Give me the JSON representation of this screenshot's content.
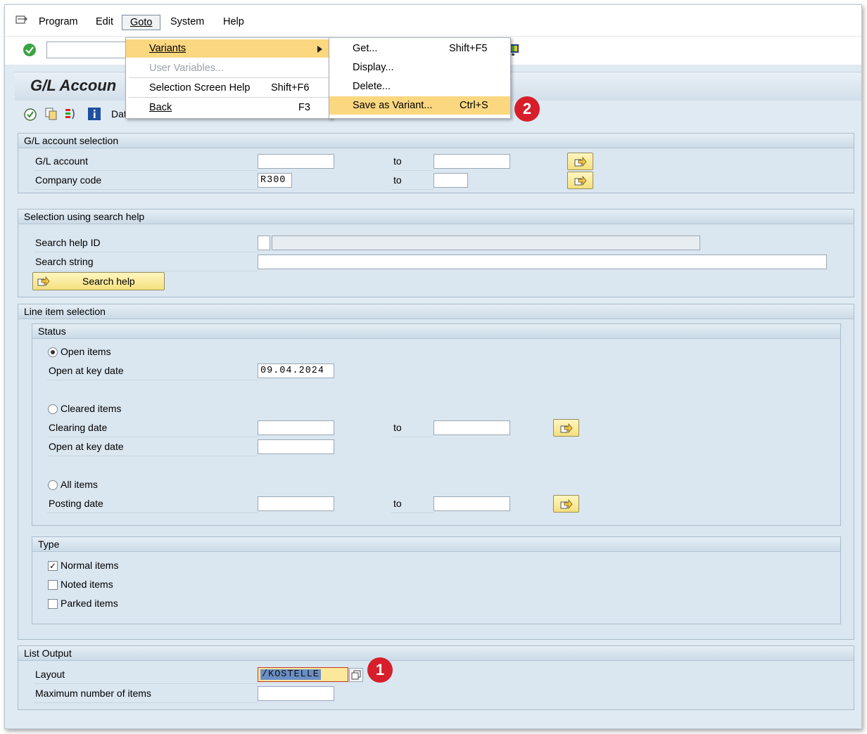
{
  "menubar": {
    "items": [
      "Program",
      "Edit",
      "Goto",
      "System",
      "Help"
    ]
  },
  "title": "G/L Accoun",
  "apptoolbar": {
    "truncated_label": "Dat"
  },
  "goto_menu": {
    "items": [
      {
        "label": "Variants",
        "shortcut": ""
      },
      {
        "label": "User Variables...",
        "shortcut": ""
      },
      {
        "label": "Selection Screen Help",
        "shortcut": "Shift+F6"
      },
      {
        "label": "Back",
        "shortcut": "F3"
      }
    ]
  },
  "variants_menu": {
    "items": [
      {
        "label": "Get...",
        "shortcut": "Shift+F5"
      },
      {
        "label": "Display...",
        "shortcut": ""
      },
      {
        "label": "Delete...",
        "shortcut": ""
      },
      {
        "label": "Save as Variant...",
        "shortcut": "Ctrl+S"
      }
    ]
  },
  "gl_selection": {
    "heading": "G/L account selection",
    "gl_account": {
      "label": "G/L account",
      "from": "",
      "to_label": "to",
      "to": ""
    },
    "company_code": {
      "label": "Company code",
      "from": "R300",
      "to_label": "to",
      "to": ""
    }
  },
  "search_help": {
    "heading": "Selection using search help",
    "id_label": "Search help ID",
    "string_label": "Search string",
    "button": "Search help"
  },
  "line_item": {
    "heading": "Line item selection",
    "status": {
      "heading": "Status",
      "open_items": "Open items",
      "open_key_date_label": "Open at key date",
      "open_key_date": "09.04.2024",
      "cleared_items": "Cleared items",
      "clearing_date_label": "Clearing date",
      "to_label": "to",
      "cleared_key_date_label": "Open at key date",
      "all_items": "All items",
      "posting_date_label": "Posting date"
    },
    "type": {
      "heading": "Type",
      "normal": "Normal items",
      "noted": "Noted items",
      "parked": "Parked items"
    }
  },
  "list_output": {
    "heading": "List Output",
    "layout_label": "Layout",
    "layout_value": "/KOSTELLE",
    "max_items_label": "Maximum number of items"
  },
  "badges": [
    "1",
    "2"
  ],
  "colors": {
    "accent": "#fbd780",
    "badge": "#d61f2b",
    "background": "#dfeaf3"
  }
}
